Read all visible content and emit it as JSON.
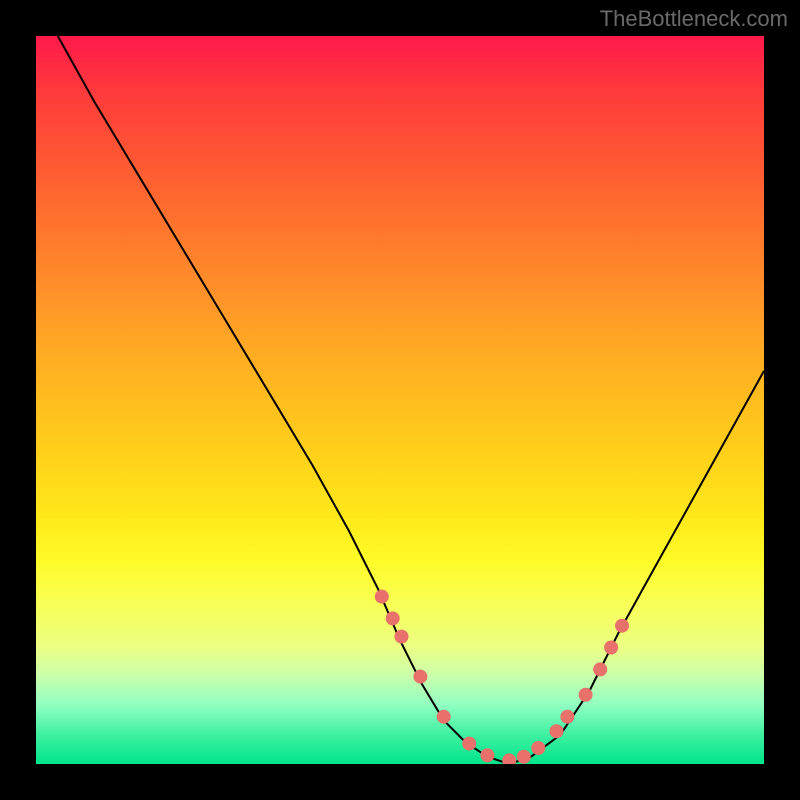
{
  "attribution": "TheBottleneck.com",
  "chart_data": {
    "type": "line",
    "title": "",
    "xlabel": "",
    "ylabel": "",
    "xlim": [
      0,
      100
    ],
    "ylim": [
      0,
      100
    ],
    "curve": {
      "x": [
        3,
        8,
        14,
        20,
        26,
        32,
        38,
        43,
        47,
        50,
        53,
        56,
        59,
        62,
        65,
        68,
        72,
        76,
        80,
        85,
        90,
        95,
        100
      ],
      "y": [
        100,
        91,
        81,
        71,
        61,
        51,
        41,
        32,
        24,
        17,
        11,
        6,
        3,
        1,
        0,
        1,
        4,
        10,
        18,
        27,
        36,
        45,
        54
      ]
    },
    "dots": {
      "x": [
        47.5,
        49.0,
        50.2,
        52.8,
        56.0,
        59.5,
        62.0,
        65.0,
        67.0,
        69.0,
        71.5,
        73.0,
        75.5,
        77.5,
        79.0,
        80.5
      ],
      "y": [
        23.0,
        20.0,
        17.5,
        12.0,
        6.5,
        2.8,
        1.2,
        0.5,
        1.0,
        2.2,
        4.5,
        6.5,
        9.5,
        13.0,
        16.0,
        19.0
      ]
    },
    "gradient_direction": "vertical",
    "gradient_colors_top_to_bottom": [
      "#ff1a4a",
      "#ffd21a",
      "#00e58a"
    ]
  }
}
